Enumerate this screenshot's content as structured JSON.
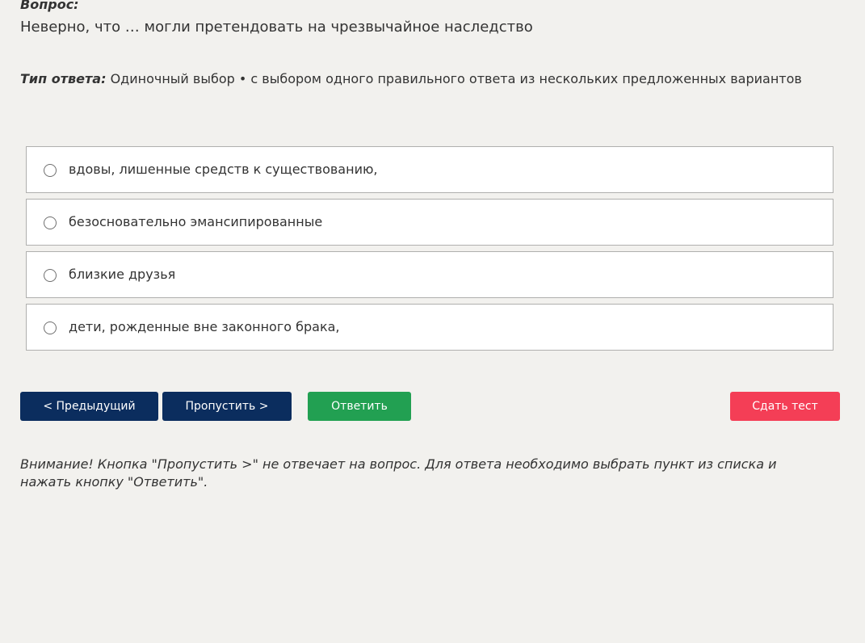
{
  "question": {
    "label": "Вопрос:",
    "text": "Неверно, что … могли претендовать на чрезвычайное наследство"
  },
  "answer_type": {
    "label": "Тип ответа:",
    "value": "Одиночный выбор • с выбором одного правильного ответа из нескольких предложенных вариантов"
  },
  "options": [
    {
      "label": "вдовы, лишенные средств к существованию,",
      "selected": false
    },
    {
      "label": "безосновательно эмансипированные",
      "selected": false
    },
    {
      "label": "близкие друзья",
      "selected": false
    },
    {
      "label": "дети, рожденные вне законного брака,",
      "selected": false
    }
  ],
  "buttons": {
    "prev": "< Предыдущий",
    "skip": "Пропустить >",
    "answer": "Ответить",
    "submit": "Сдать тест"
  },
  "notice": "Внимание! Кнопка \"Пропустить >\" не отвечает на вопрос. Для ответа необходимо выбрать пункт из списка и нажать кнопку \"Ответить\".",
  "colors": {
    "background": "#f2f1ee",
    "nav_button": "#0b2d5e",
    "answer_button": "#22a052",
    "submit_button": "#f43e56"
  }
}
